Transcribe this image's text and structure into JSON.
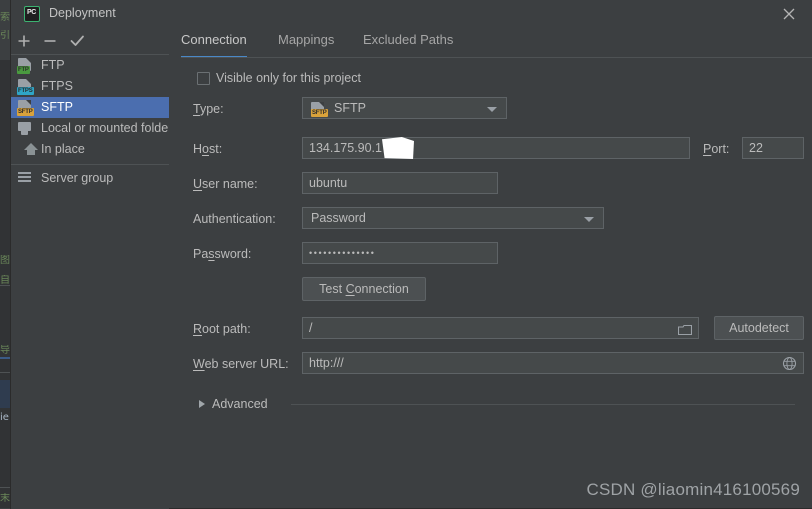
{
  "window": {
    "title": "Deployment",
    "app_icon": "PC",
    "close_icon": "close-icon"
  },
  "toolbar": {
    "add_label": "+",
    "remove_label": "−",
    "check_label": "✓"
  },
  "sidebar": {
    "items": [
      {
        "label": "FTP",
        "icon": "ftp-icon",
        "badge": "FTP",
        "badge_color": "#4a9a3f",
        "selected": false
      },
      {
        "label": "FTPS",
        "icon": "ftps-icon",
        "badge": "FTPS",
        "badge_color": "#2fa5c7",
        "selected": false
      },
      {
        "label": "SFTP",
        "icon": "sftp-icon",
        "badge": "SFTP",
        "badge_color": "#d9a23b",
        "selected": true
      },
      {
        "label": "Local or mounted folder",
        "icon": "monitor-icon",
        "badge": "",
        "badge_color": "",
        "selected": false
      },
      {
        "label": "In place",
        "icon": "house-icon",
        "badge": "",
        "badge_color": "",
        "selected": false
      },
      {
        "label": "Server group",
        "icon": "server-group-icon",
        "badge": "",
        "badge_color": "",
        "selected": false
      }
    ]
  },
  "tabs": [
    {
      "label": "Connection",
      "active": true
    },
    {
      "label": "Mappings",
      "active": false
    },
    {
      "label": "Excluded Paths",
      "active": false
    }
  ],
  "form": {
    "visible_only_label": "Visible only for this project",
    "visible_only_checked": false,
    "type_label": "Type:",
    "type_label_mnemonic": "T",
    "type_value": "SFTP",
    "host_label": "Host:",
    "host_label_mnemonic": "o",
    "host_value": "134.175.90.1",
    "port_label": "Port:",
    "port_label_mnemonic": "P",
    "port_value": "22",
    "username_label": "User name:",
    "username_label_mnemonic": "U",
    "username_value": "ubuntu",
    "auth_label": "Authentication:",
    "auth_value": "Password",
    "password_label": "Password:",
    "password_label_mnemonic": "s",
    "password_value": "••••••••••••••",
    "test_connection_label": "Test Connection",
    "test_connection_mnemonic": "C",
    "root_path_label": "Root path:",
    "root_path_mnemonic": "R",
    "root_path_value": "/",
    "root_path_browse_icon": "folder-icon",
    "autodetect_label": "Autodetect",
    "web_url_label": "Web server URL:",
    "web_url_mnemonic": "W",
    "web_url_value": "http:///",
    "web_url_globe_icon": "globe-icon",
    "advanced_label": "Advanced",
    "advanced_expanded": false
  },
  "watermark": "CSDN @liaomin416100569",
  "colors": {
    "dialog_bg": "#3c3f41",
    "selection_blue": "#4b6eaf",
    "tab_accent": "#4a88c7",
    "field_bg": "#45494a",
    "field_border": "#5e6366",
    "text": "#bbbbbb"
  },
  "ide_background": {
    "lines": [
      "索",
      "引",
      "图…",
      "自…",
      "导…",
      "ie",
      "末"
    ]
  }
}
